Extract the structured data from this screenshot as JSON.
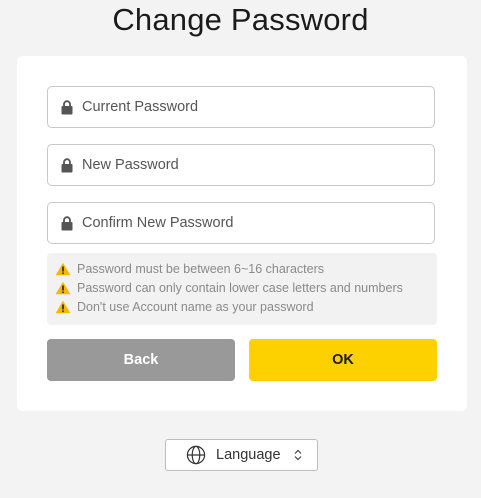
{
  "page": {
    "title": "Change Password"
  },
  "form": {
    "current_password": {
      "placeholder": "Current Password",
      "value": ""
    },
    "new_password": {
      "placeholder": "New Password",
      "value": ""
    },
    "confirm_password": {
      "placeholder": "Confirm New Password",
      "value": ""
    }
  },
  "notes": [
    {
      "text": "Password must be between 6~16 characters",
      "icon": "warning-icon"
    },
    {
      "text": "Password can only contain lower case letters and numbers",
      "icon": "warning-icon"
    },
    {
      "text": "Don't use Account name as your password",
      "icon": "warning-icon"
    }
  ],
  "buttons": {
    "back_label": "Back",
    "ok_label": "OK"
  },
  "language": {
    "label": "Language",
    "icon": "globe-icon"
  },
  "colors": {
    "accent": "#fdd000",
    "back_button": "#999999",
    "warning": "#f5b800",
    "background": "#f3f3f3"
  }
}
